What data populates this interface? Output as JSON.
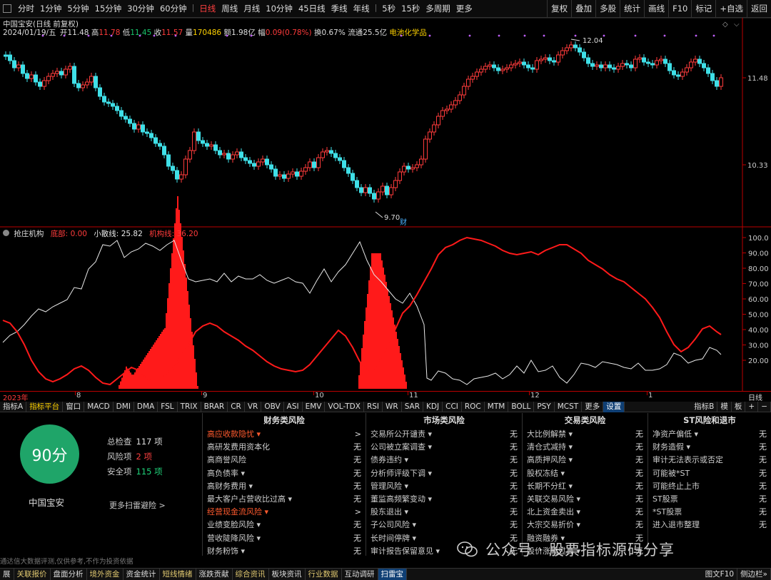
{
  "topbar": {
    "periods": [
      "分时",
      "1分钟",
      "5分钟",
      "15分钟",
      "30分钟",
      "60分钟",
      "日线",
      "周线",
      "月线",
      "10分钟",
      "45日线",
      "季线",
      "年线",
      "5秒",
      "15秒",
      "多周期",
      "更多"
    ],
    "active_period": "日线",
    "tools": [
      "复权",
      "叠加",
      "多股",
      "统计",
      "画线",
      "F10",
      "标记",
      "+自选",
      "返回"
    ]
  },
  "info": {
    "title": "中国宝安(日线 前复权)",
    "date": "2024/01/19/五",
    "open_label": "开",
    "open": "11.48",
    "high_label": "高",
    "high": "11.78",
    "low_label": "低",
    "low": "11.45",
    "close_label": "收",
    "close": "11.57",
    "volume_label": "量",
    "volume": "170486",
    "amount_label": "额",
    "amount": "1.98亿",
    "change_label": "幅",
    "change": "0.09(0.78%)",
    "turnover_label": "换",
    "turnover": "0.67%",
    "float_label": "流通",
    "float": "25.5亿",
    "sector": "电池化学品"
  },
  "price_axis": [
    "11.48",
    "10.33"
  ],
  "annotations": {
    "high_mark": "12.04",
    "low_mark": "9.70",
    "cai": "财"
  },
  "indicator": {
    "name": "抢庄机构",
    "s1_label": "底部:",
    "s1_value": "0.00",
    "s2_label": "小散线:",
    "s2_value": "25.82",
    "s3_label": "机构线:",
    "s3_value": "36.20",
    "axis": [
      "100.0",
      "90.00",
      "80.00",
      "70.00",
      "60.00",
      "50.00",
      "40.00",
      "30.00",
      "20.00"
    ]
  },
  "datebar": {
    "labels": [
      "2023年",
      "8",
      "9",
      "10",
      "11",
      "12",
      "1"
    ],
    "right": "日线"
  },
  "tabs": [
    "指标A",
    "指标平台",
    "窗口",
    "MACD",
    "DMI",
    "DMA",
    "FSL",
    "TRIX",
    "BRAR",
    "CR",
    "VR",
    "OBV",
    "ASI",
    "EMV",
    "VOL-TDX",
    "RSI",
    "WR",
    "SAR",
    "KDJ",
    "CCI",
    "ROC",
    "MTM",
    "BOLL",
    "PSY",
    "MCST",
    "更多",
    "设置"
  ],
  "tabs_right": [
    "指标B",
    "模",
    "板",
    "+",
    "−"
  ],
  "scan": {
    "score": "90分",
    "stock": "中国宝安",
    "total_label": "总检查",
    "total": "117 项",
    "risk_label": "风险项",
    "risk": "2 项",
    "safe_label": "安全项",
    "safe": "115 项",
    "more": "更多扫雷避险 >",
    "disclaimer": "通达信大数据评测,仅供参考,不作为投资依据"
  },
  "columns": [
    {
      "title": "财务类风险",
      "rows": [
        {
          "label": "高应收款隐忧 ▾",
          "value": ">",
          "alert": true
        },
        {
          "label": "高研发费用资本化",
          "value": "无"
        },
        {
          "label": "高商誉风险",
          "value": "无"
        },
        {
          "label": "高负债率 ▾",
          "value": "无"
        },
        {
          "label": "高财务费用 ▾",
          "value": "无"
        },
        {
          "label": "最大客户占营收比过高 ▾",
          "value": "无"
        },
        {
          "label": "经营现金流风险 ▾",
          "value": ">",
          "alert": true
        },
        {
          "label": "业绩变脸风险 ▾",
          "value": "无"
        },
        {
          "label": "营收陡降风险 ▾",
          "value": "无"
        },
        {
          "label": "财务粉饰 ▾",
          "value": "无"
        }
      ]
    },
    {
      "title": "市场类风险",
      "rows": [
        {
          "label": "交易所公开谴责 ▾",
          "value": "无"
        },
        {
          "label": "公司被立案调查 ▾",
          "value": "无"
        },
        {
          "label": "债券违约 ▾",
          "value": "无"
        },
        {
          "label": "分析师评级下调 ▾",
          "value": "无"
        },
        {
          "label": "管理风险 ▾",
          "value": "无"
        },
        {
          "label": "董监高频繁变动 ▾",
          "value": "无"
        },
        {
          "label": "股东退出 ▾",
          "value": "无"
        },
        {
          "label": "子公司风险 ▾",
          "value": "无"
        },
        {
          "label": "长时间停牌 ▾",
          "value": "无"
        },
        {
          "label": "审计报告保留意见 ▾",
          "value": "无"
        }
      ]
    },
    {
      "title": "交易类风险",
      "rows": [
        {
          "label": "大比例解禁 ▾",
          "value": "无"
        },
        {
          "label": "清仓式减持 ▾",
          "value": "无"
        },
        {
          "label": "高质押风险 ▾",
          "value": "无"
        },
        {
          "label": "股权冻结 ▾",
          "value": "无"
        },
        {
          "label": "长期不分红 ▾",
          "value": "无"
        },
        {
          "label": "关联交易风险 ▾",
          "value": "无"
        },
        {
          "label": "北上资金卖出 ▾",
          "value": "无"
        },
        {
          "label": "大宗交易折价 ▾",
          "value": "无"
        },
        {
          "label": "融资融券 ▾",
          "value": "无"
        },
        {
          "label": "股价涨幅过高 ▾",
          "value": "无"
        }
      ]
    },
    {
      "title": "ST风险和退市",
      "rows": [
        {
          "label": "净资产偏低 ▾",
          "value": "无"
        },
        {
          "label": "财务造假 ▾",
          "value": "无"
        },
        {
          "label": "审计无法表示或否定",
          "value": "无"
        },
        {
          "label": "可能被*ST",
          "value": "无"
        },
        {
          "label": "可能终止上市",
          "value": "无"
        },
        {
          "label": "ST股票",
          "value": "无"
        },
        {
          "label": "*ST股票",
          "value": "无"
        },
        {
          "label": "进入退市整理",
          "value": "无"
        }
      ]
    }
  ],
  "bottombar": [
    "展",
    "关联报价",
    "盘面分析",
    "境外资金",
    "资金统计",
    "短线情绪",
    "涨跌贡献",
    "综合资讯",
    "板块资讯",
    "行业数据",
    "互动调研",
    "扫雷宝"
  ],
  "bottom_active": "扫雷宝",
  "bottom_right": [
    "图文F10",
    "侧边栏»"
  ],
  "watermark": "公众号 · 股票指标源码分享",
  "colors": {
    "up": "#ff3b3b",
    "down": "#3fe0e8",
    "white": "#e8e8e8",
    "score": "#1fa569",
    "yellow": "#ffd200"
  }
}
